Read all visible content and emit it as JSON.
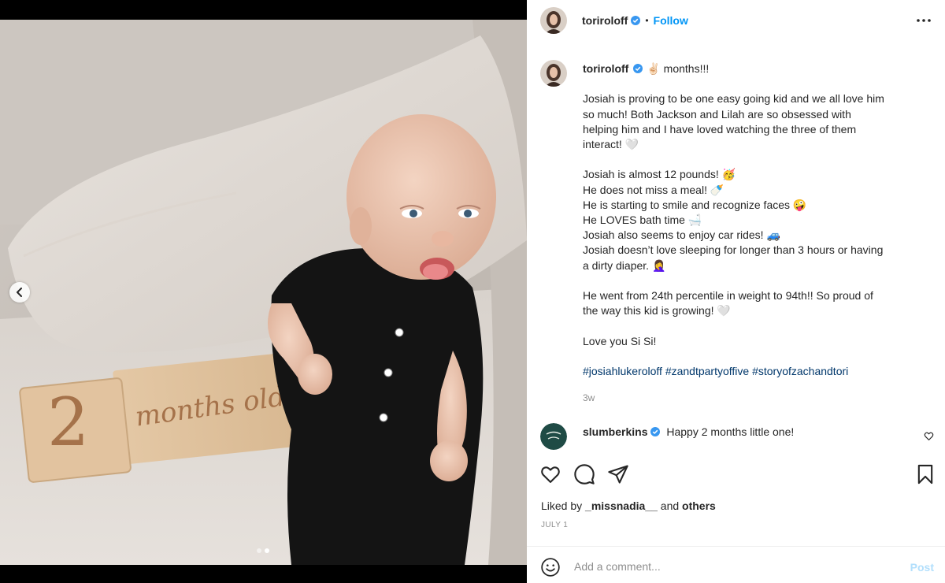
{
  "post": {
    "author": "toriroloff",
    "follow_label": "Follow",
    "separator": "•",
    "media": {
      "card_number": "2",
      "card_text": "months old",
      "slide_count": 2,
      "active_slide": 2
    }
  },
  "caption": {
    "author": "toriroloff",
    "first_line": "months!!!",
    "lines": [
      "Josiah is proving to be one easy going kid and we all love him",
      "so much! Both Jackson and Lilah are so obsessed with",
      "helping him and I have loved watching the three of them",
      "interact! 🤍",
      "",
      "Josiah is almost 12 pounds! 🥳",
      "He does not miss a meal! 🍼",
      "He is starting to smile and recognize faces 🤪",
      "He LOVES bath time 🛁",
      "Josiah also seems to enjoy car rides! 🚙",
      "Josiah doesn’t love sleeping for longer than 3 hours or having",
      "a dirty diaper. 🤦‍♀️",
      "",
      "He went from 24th percentile in weight to 94th!! So proud of",
      "the way this kid is growing! 🤍",
      "",
      "Love you Si Si!",
      ""
    ],
    "hashtags": [
      "#josiahlukeroloff",
      "#zandtpartyoffive",
      "#storyofzachandtori"
    ],
    "age": "3w"
  },
  "comment": {
    "author": "slumberkins",
    "text": "Happy 2 months little one!"
  },
  "likes": {
    "prefix": "Liked by",
    "user": "_missnadia__",
    "middle": "and",
    "suffix": "others"
  },
  "date": "JULY 1",
  "add_comment": {
    "placeholder": "Add a comment...",
    "post_label": "Post"
  },
  "colors": {
    "accent": "#0095f6",
    "hashtag": "#00376b",
    "muted": "#8e8e8e",
    "post_disabled": "#b2dffc"
  }
}
